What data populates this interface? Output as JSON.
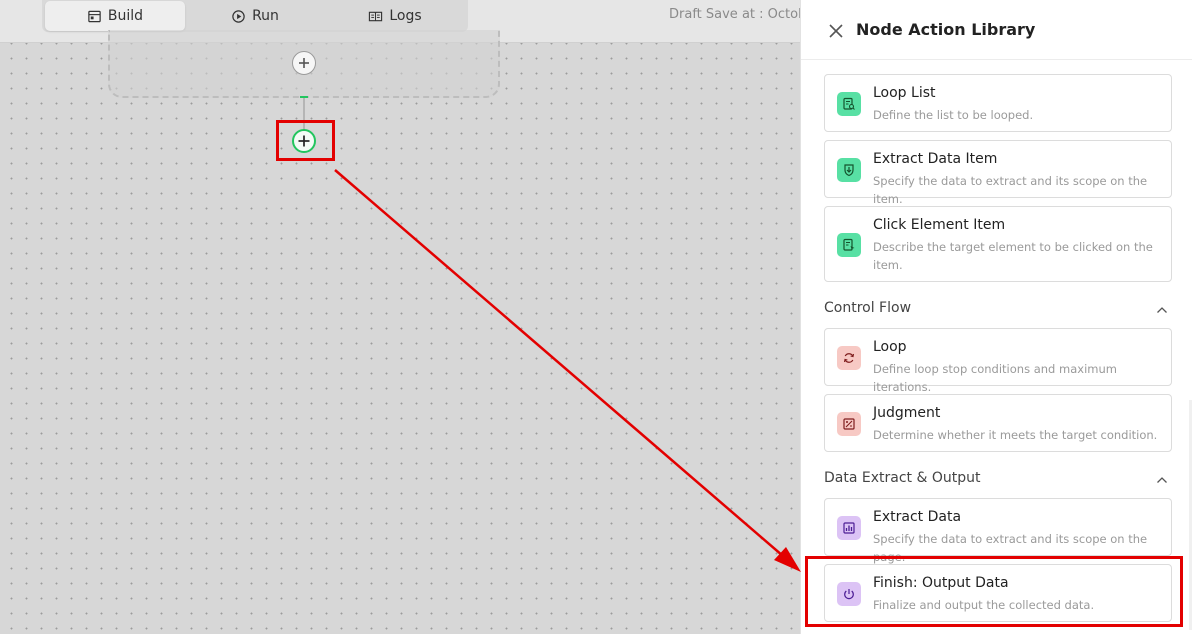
{
  "topbar": {
    "tabs": [
      {
        "label": "Build",
        "icon": "build-icon",
        "active": true
      },
      {
        "label": "Run",
        "icon": "run-icon",
        "active": false
      },
      {
        "label": "Logs",
        "icon": "logs-icon",
        "active": false
      }
    ],
    "draft_text": "Draft Save at : October"
  },
  "canvas": {
    "accent_color": "#22c55e",
    "highlight_color": "#e30000"
  },
  "panel": {
    "title": "Node Action Library",
    "cards_top": [
      {
        "title": "Loop List",
        "desc": "Define the list to be looped.",
        "icon": "list-search-icon",
        "color": "#58e0a4"
      },
      {
        "title": "Extract Data Item",
        "desc": "Specify the data to extract and its scope on the item.",
        "icon": "download-shield-icon",
        "color": "#58e0a4"
      },
      {
        "title": "Click Element Item",
        "desc": "Describe the target element to be clicked on the item.",
        "icon": "click-list-icon",
        "color": "#58e0a4"
      }
    ],
    "control_flow": {
      "title": "Control Flow",
      "cards": [
        {
          "title": "Loop",
          "desc": "Define loop stop conditions and maximum iterations.",
          "icon": "loop-icon",
          "color": "#f7c9c4"
        },
        {
          "title": "Judgment",
          "desc": "Determine whether it meets the target condition.",
          "icon": "judgment-icon",
          "color": "#f7c9c4"
        }
      ]
    },
    "data_output": {
      "title": "Data Extract & Output",
      "cards": [
        {
          "title": "Extract Data",
          "desc": "Specify the data to extract and its scope on the page.",
          "icon": "chart-icon",
          "color": "#dcc3f5"
        },
        {
          "title": "Finish: Output Data",
          "desc": "Finalize and output the collected data.",
          "icon": "power-icon",
          "color": "#dcc3f5"
        }
      ]
    }
  }
}
